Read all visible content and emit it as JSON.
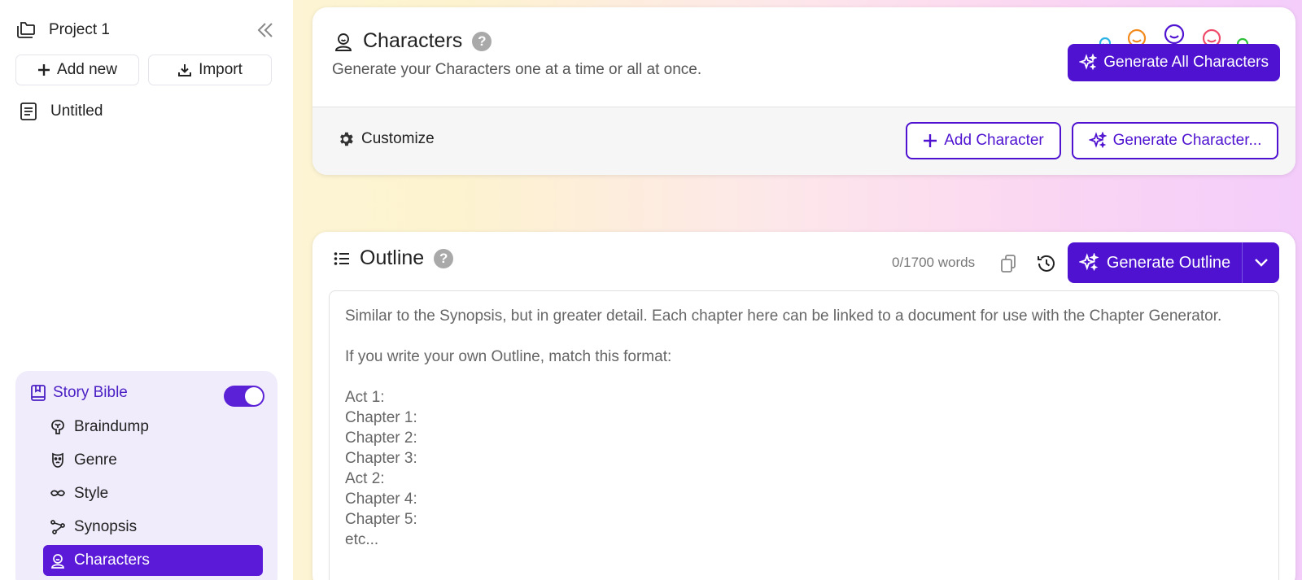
{
  "sidebar": {
    "project_title": "Project 1",
    "add_new_label": "Add new",
    "import_label": "Import",
    "documents": [
      {
        "label": "Untitled"
      }
    ],
    "story_bible": {
      "label": "Story Bible",
      "enabled": true,
      "items": [
        {
          "label": "Braindump",
          "icon": "brain-icon"
        },
        {
          "label": "Genre",
          "icon": "mask-icon"
        },
        {
          "label": "Style",
          "icon": "mustache-icon"
        },
        {
          "label": "Synopsis",
          "icon": "synopsis-icon"
        },
        {
          "label": "Characters",
          "icon": "character-icon",
          "active": true
        }
      ]
    }
  },
  "characters_card": {
    "title": "Characters",
    "subtitle": "Generate your Characters one at a time or all at once.",
    "generate_all_label": "Generate All Characters",
    "customize_label": "Customize",
    "add_character_label": "Add Character",
    "generate_character_label": "Generate Character..."
  },
  "outline_card": {
    "title": "Outline",
    "word_count": "0/1700 words",
    "generate_label": "Generate Outline",
    "placeholder_lines": [
      "Similar to the Synopsis, but in greater detail. Each chapter here can be linked to a document for use with the Chapter Generator.",
      "",
      "If you write your own Outline, match this format:",
      "",
      "Act 1:",
      "Chapter 1:",
      "Chapter 2:",
      "Chapter 3:",
      "Act 2:",
      "Chapter 4:",
      "Chapter 5:",
      "etc..."
    ]
  },
  "colors": {
    "accent": "#4e12d0",
    "accent_text": "#4a1fc4",
    "bible_bg": "#f0ecfc",
    "face_colors": [
      "#2bb3e6",
      "#f28a1e",
      "#4e12d0",
      "#ef4b6a",
      "#2fbf3a"
    ]
  }
}
